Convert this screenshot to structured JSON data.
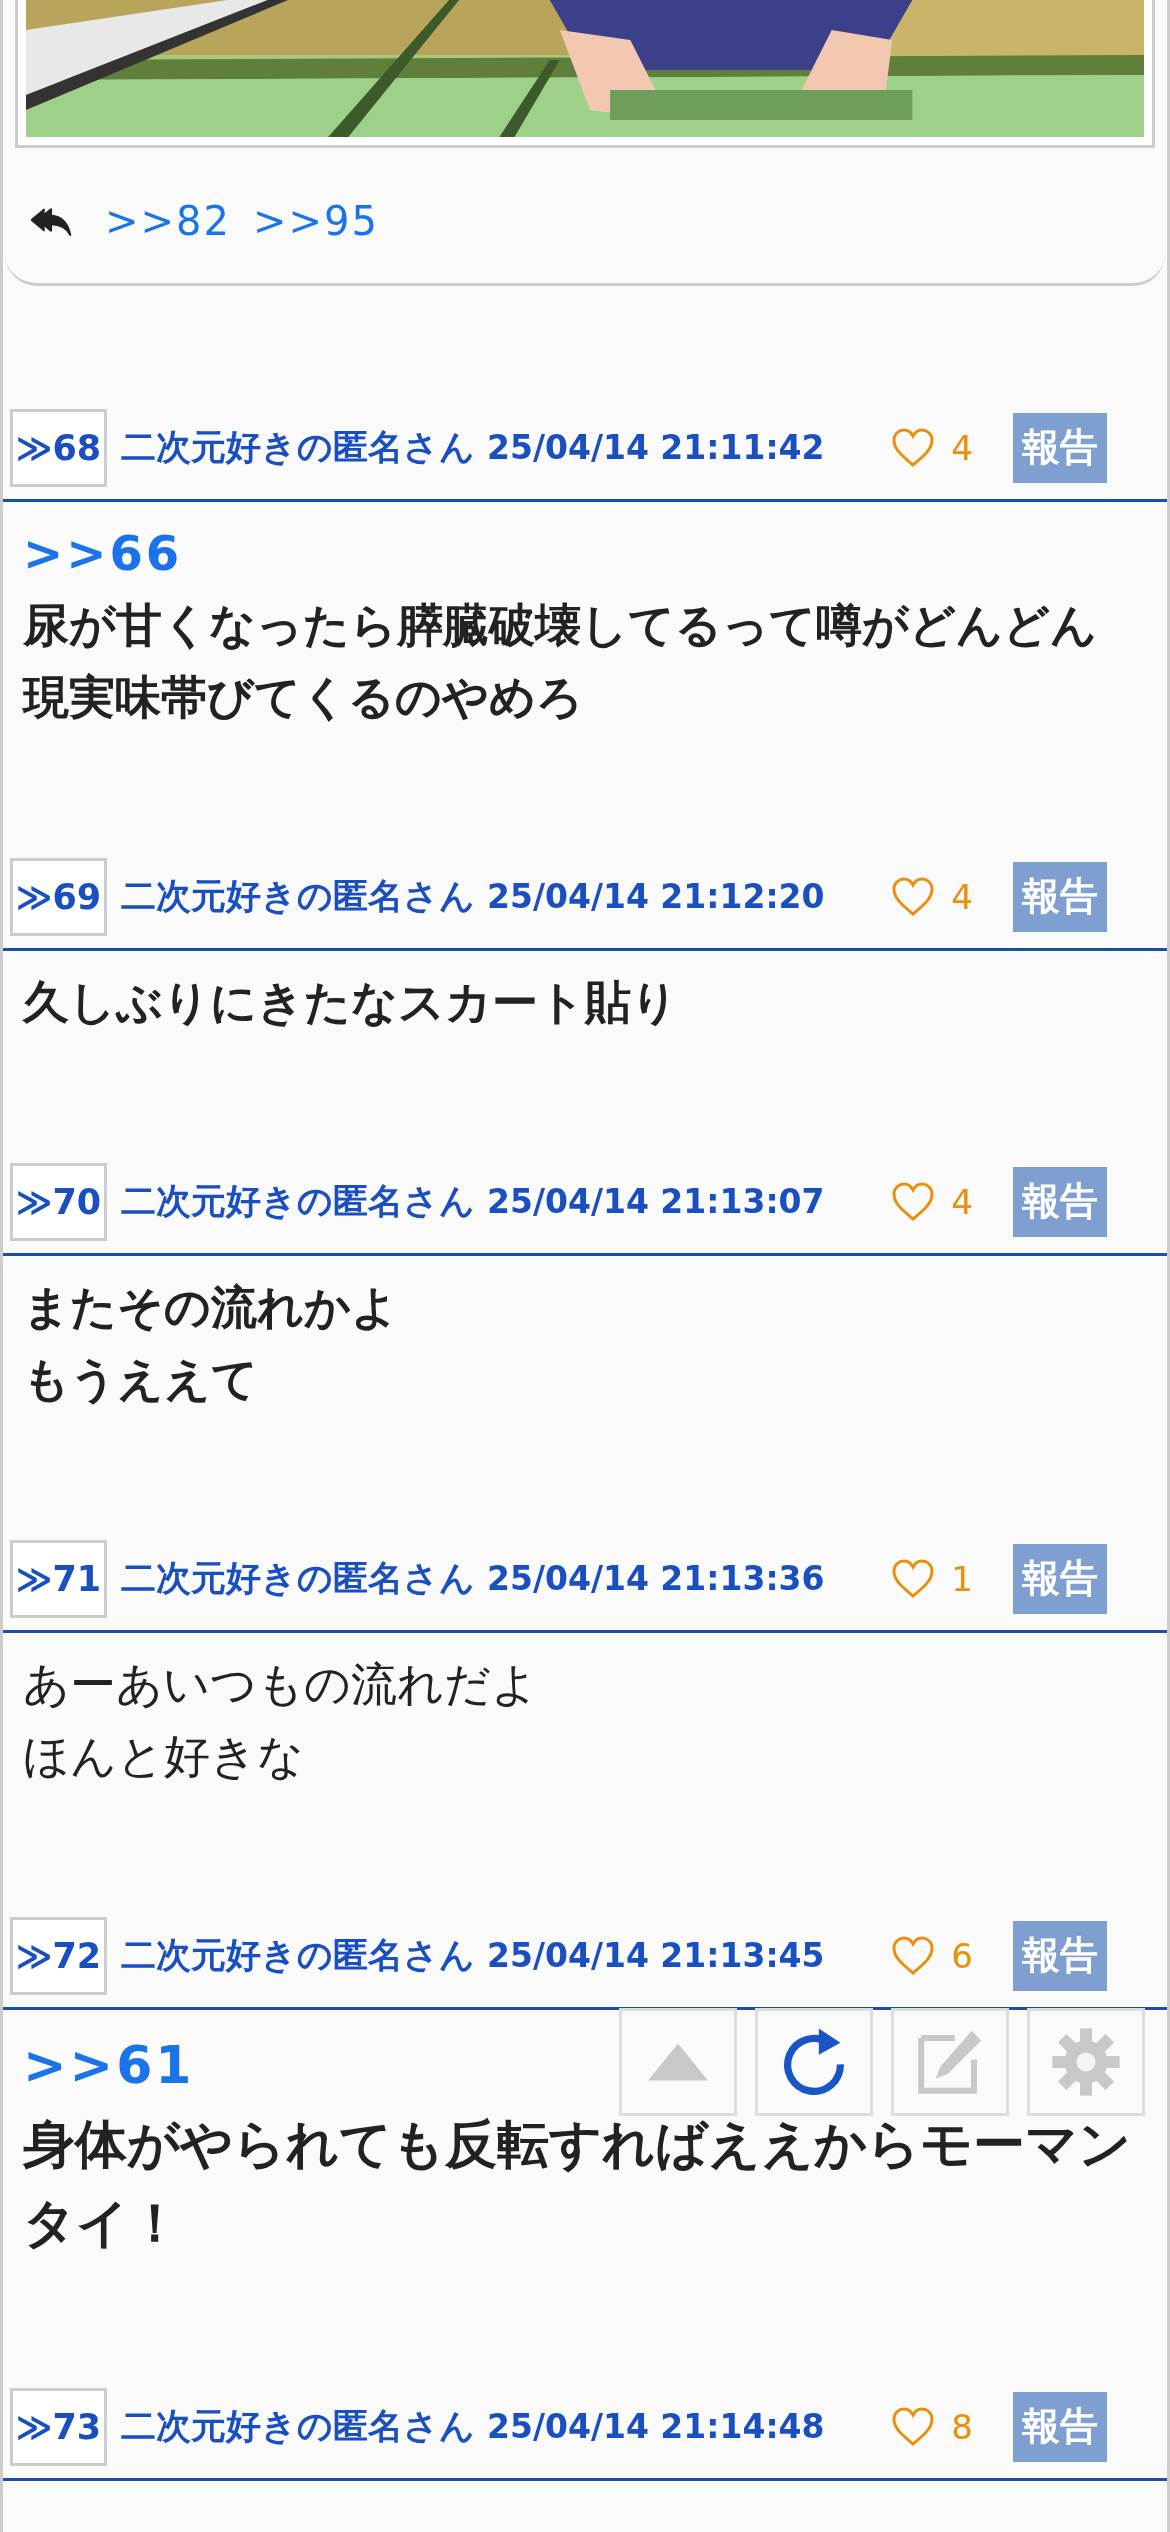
{
  "reply_links": [
    ">>82",
    ">>95"
  ],
  "posts": [
    {
      "number": "≫68",
      "name": "二次元好きの匿名さん",
      "date": "25/04/14 21:11:42",
      "likes": "4",
      "report": "報告",
      "anchor": ">>66",
      "kind": "bold",
      "lines": [
        "尿が甘くなったら膵臓破壊してるって噂がどんどん",
        "現実味帯びてくるのやめろ"
      ]
    },
    {
      "number": "≫69",
      "name": "二次元好きの匿名さん",
      "date": "25/04/14 21:12:20",
      "likes": "4",
      "report": "報告",
      "kind": "bold",
      "lines": [
        "久しぶりにきたなスカート貼り"
      ]
    },
    {
      "number": "≫70",
      "name": "二次元好きの匿名さん",
      "date": "25/04/14 21:13:07",
      "likes": "4",
      "report": "報告",
      "kind": "bold",
      "lines": [
        "またその流れかよ",
        "もうええて"
      ]
    },
    {
      "number": "≫71",
      "name": "二次元好きの匿名さん",
      "date": "25/04/14 21:13:36",
      "likes": "1",
      "report": "報告",
      "kind": "normal",
      "lines": [
        "あーあいつもの流れだよ",
        "ほんと好きな"
      ]
    },
    {
      "number": "≫72",
      "name": "二次元好きの匿名さん",
      "date": "25/04/14 21:13:45",
      "likes": "6",
      "report": "報告",
      "anchor": ">>61",
      "kind": "large",
      "lines": [
        "身体がやられても反転すればええからモーマン",
        "タイ！"
      ]
    },
    {
      "number": "≫73",
      "name": "二次元好きの匿名さん",
      "date": "25/04/14 21:14:48",
      "likes": "8",
      "report": "報告"
    }
  ]
}
